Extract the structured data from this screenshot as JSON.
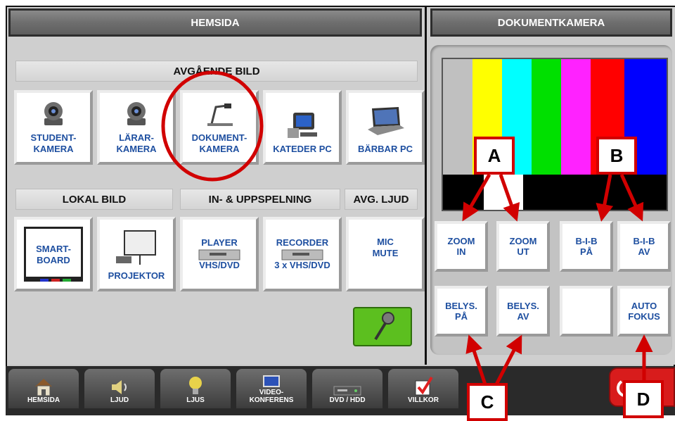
{
  "left_panel": {
    "title": "HEMSIDA",
    "section_outgoing": "AVGÅENDE BILD",
    "outgoing": [
      {
        "label": "STUDENT-\nKAMERA",
        "icon": "camera-icon"
      },
      {
        "label": "LÄRAR-\nKAMERA",
        "icon": "camera-icon"
      },
      {
        "label": "DOKUMENT-\nKAMERA",
        "icon": "document-camera-icon"
      },
      {
        "label": "KATEDER PC",
        "icon": "desktop-pc-icon"
      },
      {
        "label": "BÄRBAR PC",
        "icon": "laptop-icon"
      }
    ],
    "section_local": "LOKAL BILD",
    "section_playback": "IN- & UPPSPELNING",
    "section_audio": "AVG. LJUD",
    "lower": [
      {
        "label": "SMART-\nBOARD",
        "icon": "smartboard-icon"
      },
      {
        "label": "PROJEKTOR",
        "icon": "projector-icon"
      },
      {
        "label": "PLAYER\n\nVHS/DVD",
        "icon": "vcr-icon"
      },
      {
        "label": "RECORDER\n\n3 x VHS/DVD",
        "icon": "vcr-icon"
      },
      {
        "label": "MIC\nMUTE",
        "icon": ""
      }
    ]
  },
  "right_panel": {
    "title": "DOKUMENTKAMERA",
    "buttons": [
      {
        "label": "ZOOM\nIN"
      },
      {
        "label": "ZOOM\nUT"
      },
      {
        "label": "B-I-B\nPÅ"
      },
      {
        "label": "B-I-B\nAV"
      },
      {
        "label": "BELYS.\nPÅ"
      },
      {
        "label": "BELYS.\nAV"
      },
      {
        "label": ""
      },
      {
        "label": "AUTO\nFOKUS"
      }
    ]
  },
  "tabs": [
    {
      "label": "HEMSIDA",
      "icon": "house-icon"
    },
    {
      "label": "LJUD",
      "icon": "speaker-icon"
    },
    {
      "label": "LJUS",
      "icon": "lightbulb-icon"
    },
    {
      "label": "VIDEO-\nKONFERENS",
      "icon": "video-conference-icon"
    },
    {
      "label": "DVD / HDD",
      "icon": "dvd-icon"
    },
    {
      "label": "VILLKOR",
      "icon": "checkbox-icon"
    }
  ],
  "callouts": {
    "a": "A",
    "b": "B",
    "c": "C",
    "d": "D"
  },
  "colors": {
    "accent_red": "#d10000",
    "label_blue": "#1e4fa0",
    "mic_green": "#5cbf1f"
  }
}
